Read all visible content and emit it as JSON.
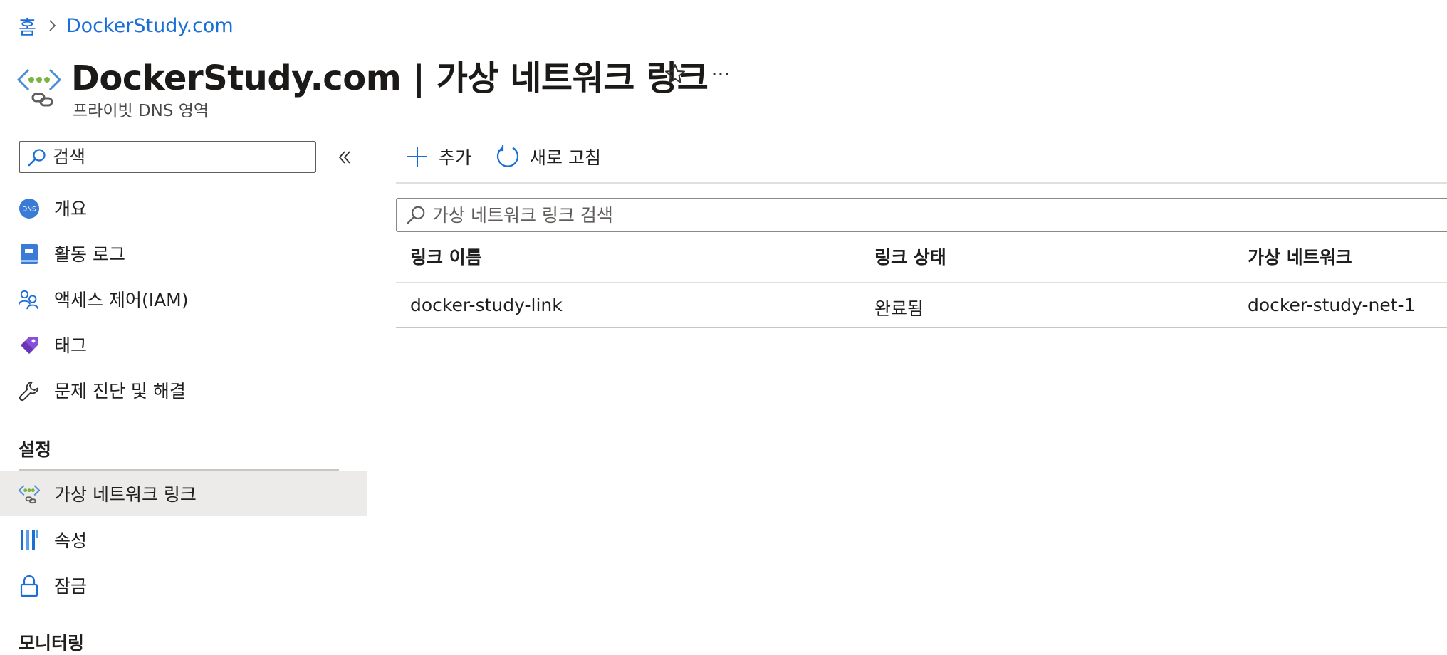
{
  "breadcrumb": {
    "home": "홈",
    "current": "DockerStudy.com"
  },
  "header": {
    "title": "DockerStudy.com | 가상 네트워크 링크",
    "subtitle": "프라이빗 DNS 영역",
    "more": "···"
  },
  "nav": {
    "search_placeholder": "검색",
    "items": [
      {
        "label": "개요",
        "icon": "dns-icon"
      },
      {
        "label": "활동 로그",
        "icon": "activity-log-icon"
      },
      {
        "label": "액세스 제어(IAM)",
        "icon": "people-icon"
      },
      {
        "label": "태그",
        "icon": "tag-icon"
      },
      {
        "label": "문제 진단 및 해결",
        "icon": "wrench-icon"
      }
    ],
    "settings_header": "설정",
    "settings_items": [
      {
        "label": "가상 네트워크 링크",
        "icon": "virtual-network-link-icon",
        "selected": true
      },
      {
        "label": "속성",
        "icon": "properties-icon"
      },
      {
        "label": "잠금",
        "icon": "lock-icon"
      }
    ],
    "monitoring_header": "모니터링"
  },
  "toolbar": {
    "add_label": "추가",
    "refresh_label": "새로 고침"
  },
  "filter": {
    "placeholder": "가상 네트워크 링크 검색"
  },
  "table": {
    "columns": [
      "링크 이름",
      "링크 상태",
      "가상 네트워크"
    ],
    "rows": [
      {
        "name": "docker-study-link",
        "status": "완료됨",
        "vnet": "docker-study-net-1"
      }
    ]
  },
  "colors": {
    "link": "#1a6ed8",
    "selected_bg": "#edebe9",
    "accent_green": "#7cb342"
  }
}
